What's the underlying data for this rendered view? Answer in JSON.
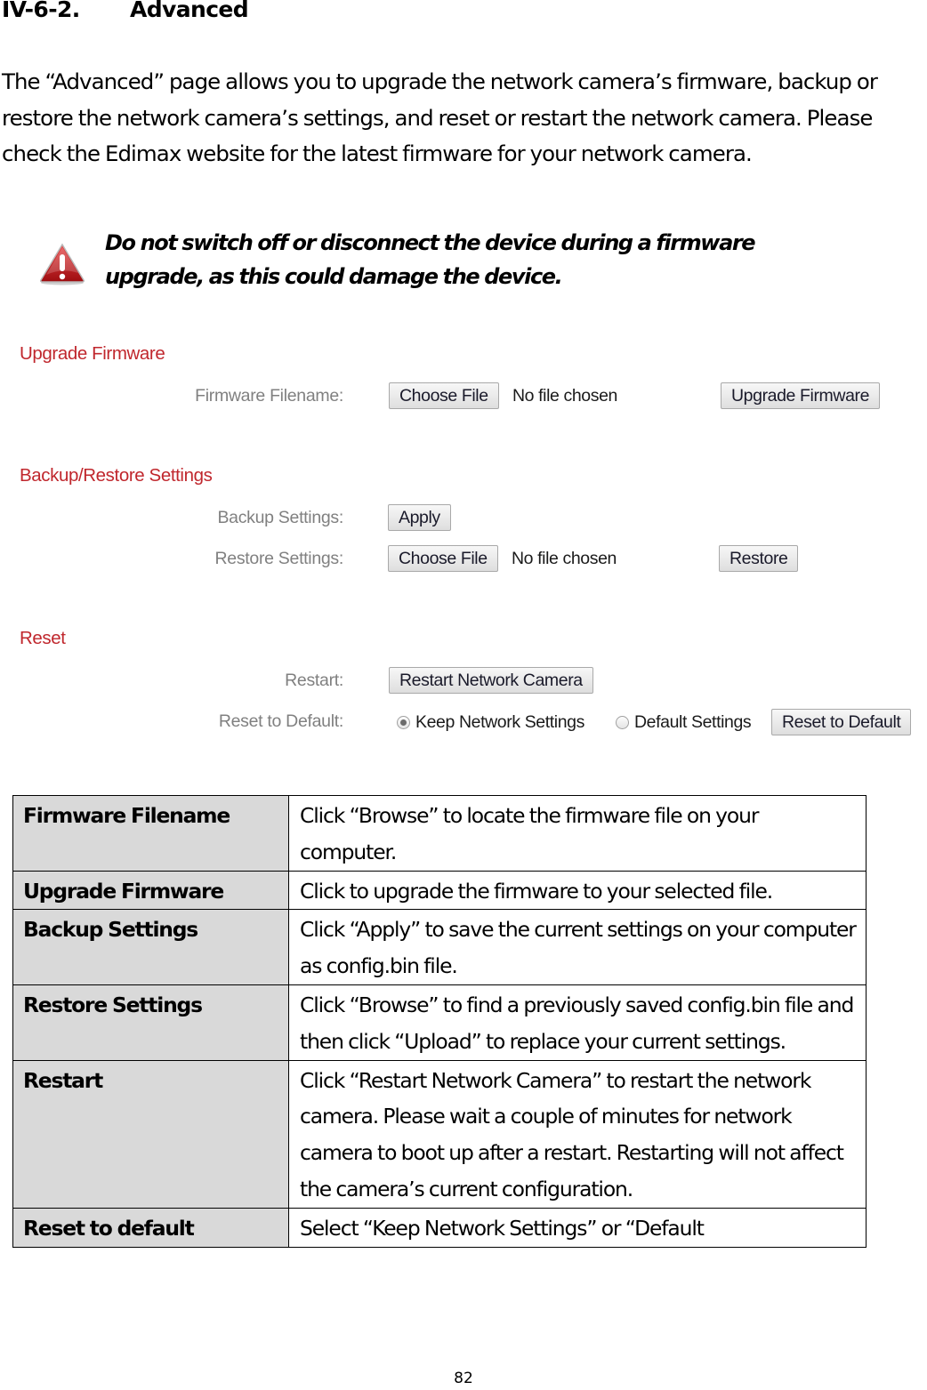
{
  "section": {
    "number": "IV-6-2.",
    "title": "Advanced"
  },
  "intro": "The “Advanced” page allows you to upgrade the network camera’s firmware, backup or restore the network camera’s settings, and reset or restart the network camera. Please check the Edimax website for the latest firmware for your network camera.",
  "warning": {
    "icon": "warning-triangle-icon",
    "line1": "Do not switch off or disconnect the device during a firmware",
    "line2": "upgrade, as this could damage the device."
  },
  "ui": {
    "upgrade": {
      "title": "Upgrade Firmware",
      "filename_label": "Firmware Filename:",
      "choose_file": "Choose File",
      "no_file": "No file chosen",
      "upgrade_button": "Upgrade Firmware"
    },
    "backup_restore": {
      "title": "Backup/Restore Settings",
      "backup_label": "Backup Settings:",
      "apply_button": "Apply",
      "restore_label": "Restore Settings:",
      "choose_file": "Choose File",
      "no_file": "No file chosen",
      "restore_button": "Restore"
    },
    "reset": {
      "title": "Reset",
      "restart_label": "Restart:",
      "restart_button": "Restart Network Camera",
      "reset_label": "Reset to Default:",
      "options": [
        {
          "label": "Keep Network Settings",
          "checked": true
        },
        {
          "label": "Default Settings",
          "checked": false
        }
      ],
      "reset_button": "Reset to Default"
    }
  },
  "table": {
    "rows": [
      {
        "key": "Firmware Filename",
        "value": "Click “Browse” to locate the firmware file on your computer."
      },
      {
        "key": "Upgrade Firmware",
        "value": "Click to upgrade the firmware to your selected file."
      },
      {
        "key": "Backup Settings",
        "value": "Click “Apply” to save the current settings on your computer as config.bin file."
      },
      {
        "key": "Restore Settings",
        "value": "Click “Browse” to find a previously saved config.bin file and then click “Upload” to replace your current settings."
      },
      {
        "key": "Restart",
        "value": "Click “Restart Network Camera” to restart the network camera. Please wait a couple of minutes for network camera to boot up after a restart. Restarting will not affect the camera’s current configuration."
      },
      {
        "key": "Reset to default",
        "value": "Select “Keep Network Settings” or “Default"
      }
    ]
  },
  "page_number": "82",
  "colors": {
    "section_title": "#c0272d",
    "field_label": "#808080",
    "table_key_bg": "#d9d9d9"
  }
}
